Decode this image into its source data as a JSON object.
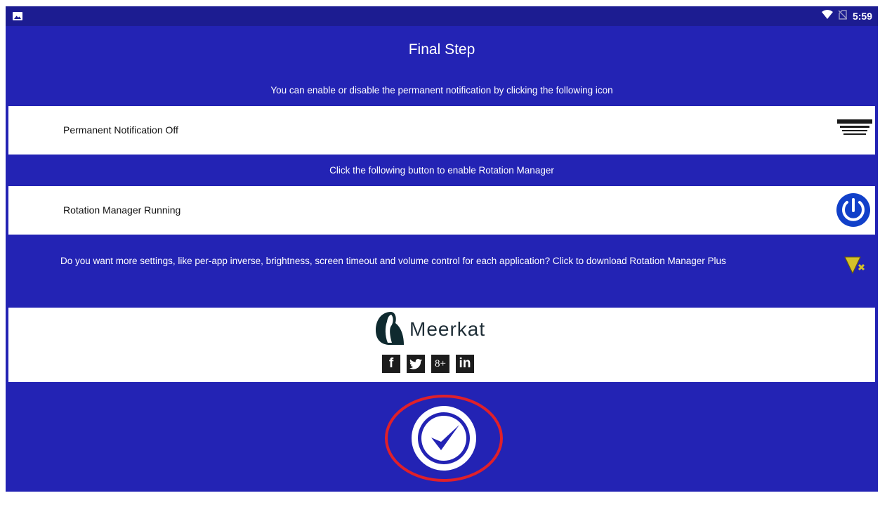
{
  "status_bar": {
    "time": "5:59",
    "left_icon": "image-notification-icon",
    "right_icons": [
      "wifi-icon",
      "no-sim-icon"
    ]
  },
  "page": {
    "title": "Final Step",
    "notification_caption": "You can enable or disable the permanent notification by clicking the following icon",
    "notification_label": "Permanent Notification Off",
    "rotation_caption": "Click the following button to enable Rotation Manager",
    "rotation_label": "Rotation Manager Running",
    "promo_text": "Do you want more settings, like per-app inverse, brightness, screen timeout and volume control for each application? Click to download Rotation Manager Plus"
  },
  "brand": {
    "name": "Meerkat",
    "social": [
      {
        "name": "facebook",
        "glyph": "f"
      },
      {
        "name": "twitter",
        "glyph": "t"
      },
      {
        "name": "google-plus",
        "glyph": "8+"
      },
      {
        "name": "linkedin",
        "glyph": "in"
      }
    ]
  },
  "colors": {
    "background": "#2323b4",
    "status_bar": "#1c1c91",
    "power_icon": "#1140c9",
    "promo_icon": "#d4c12a",
    "highlight_ring": "#e0202a"
  }
}
